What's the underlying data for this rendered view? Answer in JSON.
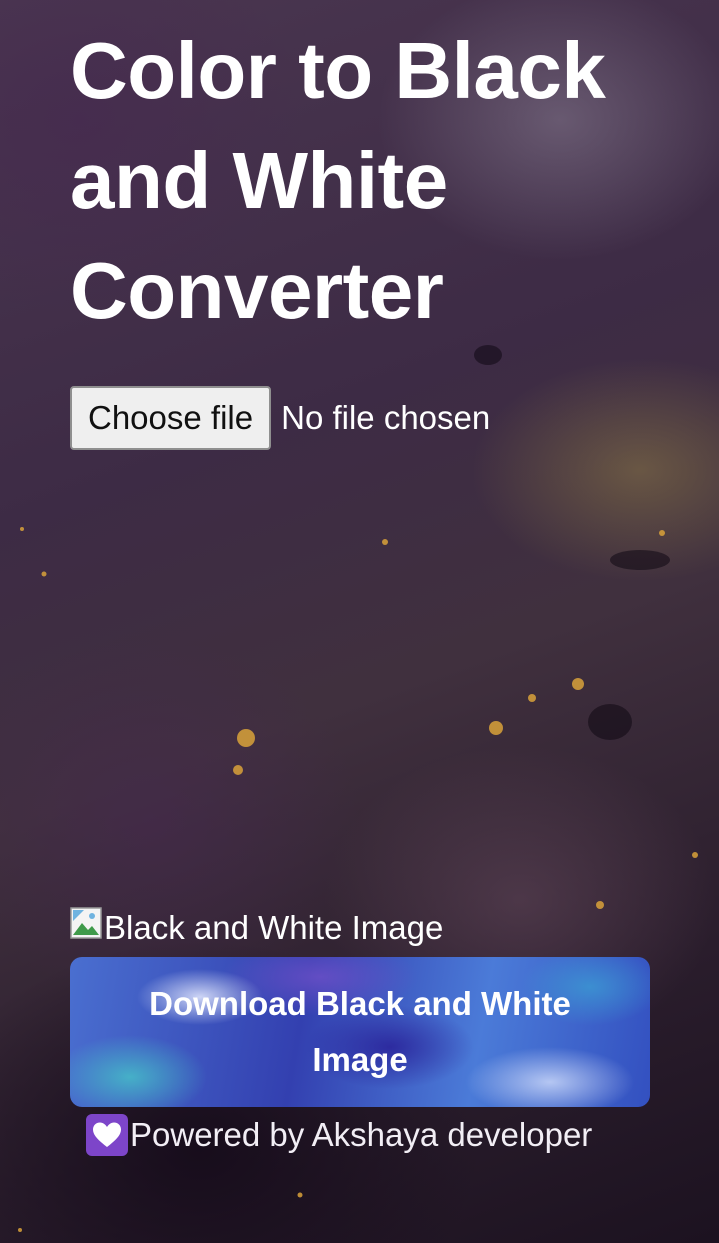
{
  "page": {
    "title": "Color to Black and White Converter"
  },
  "file_input": {
    "button_label": "Choose file",
    "status_text": "No file chosen"
  },
  "output_image": {
    "alt_text": "Black and White Image",
    "icon": "broken-image-icon"
  },
  "download": {
    "label": "Download Black and White Image"
  },
  "footer": {
    "icon": "heart-icon",
    "text": "Powered by Akshaya developer"
  },
  "colors": {
    "text": "#ffffff",
    "choose_button_bg": "#efefef",
    "download_button_bg": "#3a4fb5",
    "heart_badge": "#7d45c9"
  }
}
